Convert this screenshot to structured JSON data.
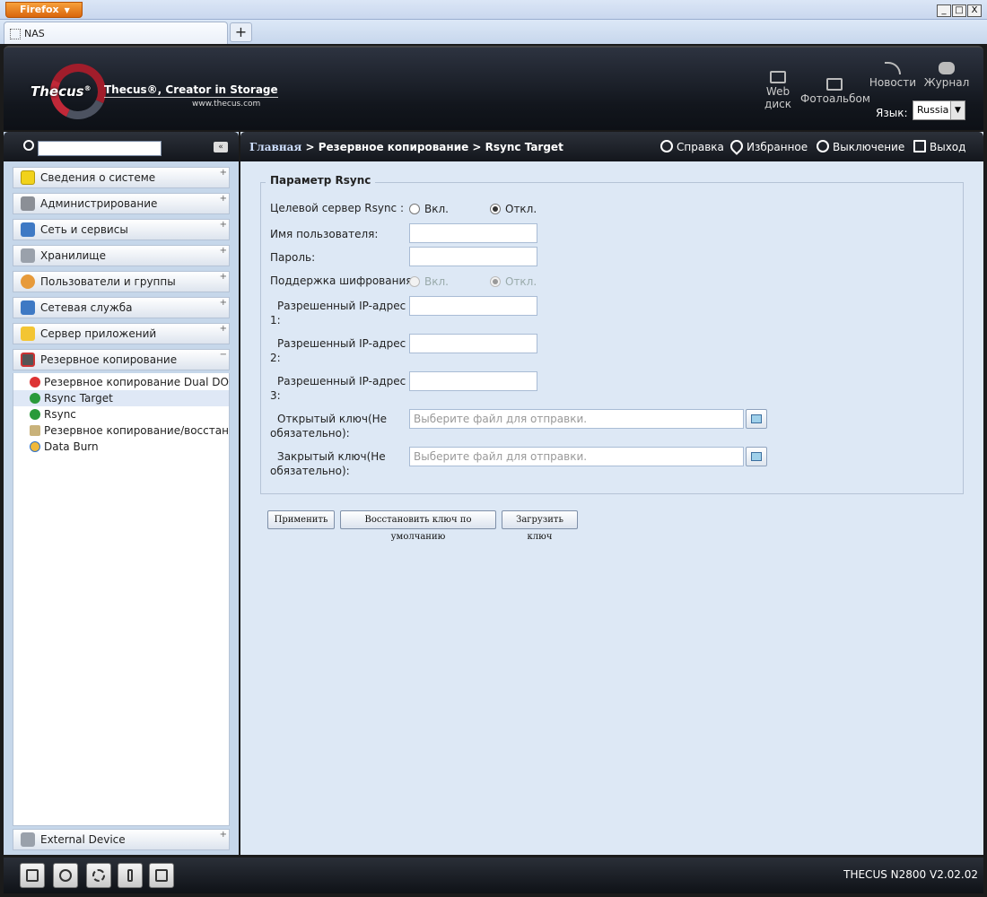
{
  "browser": {
    "menu_button": "Firefox",
    "tab_title": "NAS",
    "new_tab": "+",
    "win_min": "_",
    "win_max": "□",
    "win_close": "X"
  },
  "header": {
    "brand": "Thecus",
    "brand_mark": "®",
    "tagline": "Thecus®, Creator in Storage",
    "url": "www.thecus.com",
    "tools": [
      {
        "label1": "Web",
        "label2": "диск",
        "icon": "web-disk-icon"
      },
      {
        "label1": "Фотоальбом",
        "label2": "",
        "icon": "photo-album-icon"
      },
      {
        "label1": "Новости",
        "label2": "",
        "icon": "rss-icon"
      },
      {
        "label1": "Журнал",
        "label2": "",
        "icon": "log-icon"
      }
    ],
    "lang_label": "Язык:",
    "lang_value": "Russia"
  },
  "sidebar": {
    "collapse_icon": "«",
    "sections": [
      {
        "label": "Сведения о системе",
        "icon": "info-icon",
        "toggle": "+"
      },
      {
        "label": "Администрирование",
        "icon": "tools-icon",
        "toggle": "+"
      },
      {
        "label": "Сеть и сервисы",
        "icon": "network-icon",
        "toggle": "+"
      },
      {
        "label": "Хранилище",
        "icon": "storage-icon",
        "toggle": "+"
      },
      {
        "label": "Пользователи и группы",
        "icon": "users-icon",
        "toggle": "+"
      },
      {
        "label": "Сетевая служба",
        "icon": "network-service-icon",
        "toggle": "+"
      },
      {
        "label": "Сервер приложений",
        "icon": "app-server-icon",
        "toggle": "+"
      },
      {
        "label": "Резервное копирование",
        "icon": "backup-icon",
        "toggle": "−"
      }
    ],
    "tree": [
      {
        "label": "Резервное копирование Dual DOM",
        "icon": "dual-dom-icon"
      },
      {
        "label": "Rsync Target",
        "icon": "rsync-target-icon"
      },
      {
        "label": "Rsync",
        "icon": "rsync-icon"
      },
      {
        "label": "Резервное копирование/восстановление",
        "icon": "restore-icon"
      },
      {
        "label": "Data Burn",
        "icon": "data-burn-icon"
      }
    ],
    "external": {
      "label": "External Device",
      "icon": "external-device-icon",
      "toggle": "+"
    }
  },
  "toolbar": {
    "crumb_home": "Главная",
    "crumb_rest": " > Резервное копирование > Rsync Target",
    "help": "Справка",
    "favorites": "Избранное",
    "shutdown": "Выключение",
    "logout": "Выход"
  },
  "form": {
    "legend": "Параметр Rsync",
    "target_label": "Целевой сервер Rsync :",
    "on": "Вкл.",
    "off": "Откл.",
    "target_value": "off",
    "username_label": "Имя пользователя:",
    "username_value": "",
    "password_label": "Пароль:",
    "password_value": "",
    "encrypt_label": "Поддержка шифрования:",
    "encrypt_value": "off",
    "ip1_line1": "Разрешенный IP-адрес",
    "ip1_line2": "1:",
    "ip2_line1": "Разрешенный IP-адрес",
    "ip2_line2": "2:",
    "ip3_line1": "Разрешенный IP-адрес",
    "ip3_line2": "3:",
    "pubkey_line1": "Открытый ключ(Не",
    "pubkey_line2": "обязательно):",
    "privkey_line1": "Закрытый ключ(Не",
    "privkey_line2": "обязательно):",
    "file_placeholder": "Выберите файл для отправки.",
    "apply_button": "Применить",
    "restore_key_button": "Восстановить ключ по умолчанию",
    "upload_key_button": "Загрузить ключ"
  },
  "footer": {
    "icons": [
      "server-icon",
      "disk-icon",
      "fan-icon",
      "thermometer-icon",
      "network-tree-icon"
    ],
    "version": "THECUS N2800 V2.02.02"
  }
}
